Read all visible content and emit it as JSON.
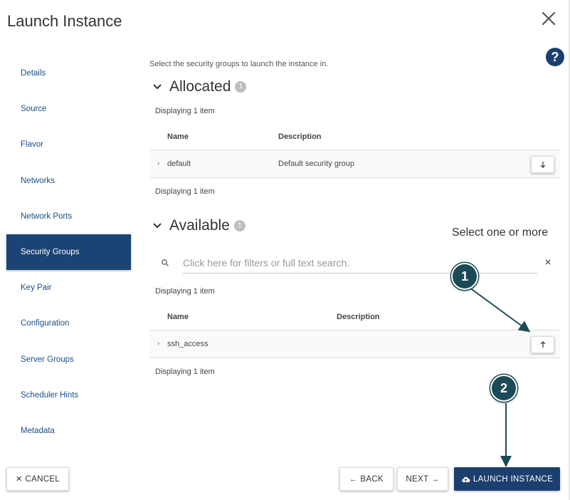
{
  "dialog": {
    "title": "Launch Instance",
    "help_label": "?"
  },
  "sidebar": {
    "items": [
      {
        "label": "Details",
        "active": false
      },
      {
        "label": "Source",
        "active": false
      },
      {
        "label": "Flavor",
        "active": false
      },
      {
        "label": "Networks",
        "active": false
      },
      {
        "label": "Network Ports",
        "active": false
      },
      {
        "label": "Security Groups",
        "active": true
      },
      {
        "label": "Key Pair",
        "active": false
      },
      {
        "label": "Configuration",
        "active": false
      },
      {
        "label": "Server Groups",
        "active": false
      },
      {
        "label": "Scheduler Hints",
        "active": false
      },
      {
        "label": "Metadata",
        "active": false
      }
    ]
  },
  "main": {
    "intro": "Select the security groups to launch the instance in.",
    "allocated": {
      "title": "Allocated",
      "count": "1",
      "display_top": "Displaying 1 item",
      "display_bottom": "Displaying 1 item",
      "col_name": "Name",
      "col_description": "Description",
      "rows": [
        {
          "name": "default",
          "description": "Default security group"
        }
      ]
    },
    "available": {
      "title": "Available",
      "count": "1",
      "hint": "Select one or more",
      "search_placeholder": "Click here for filters or full text search.",
      "display_top": "Displaying 1 item",
      "display_bottom": "Displaying 1 item",
      "col_name": "Name",
      "col_description": "Description",
      "rows": [
        {
          "name": "ssh_access",
          "description": ""
        }
      ]
    }
  },
  "annotations": {
    "marker1": "1",
    "marker2": "2",
    "color": "#1d4a57"
  },
  "footer": {
    "cancel": "CANCEL",
    "back": "BACK",
    "next": "NEXT",
    "launch": "LAUNCH INSTANCE"
  },
  "colors": {
    "primary": "#1b3f6e",
    "sidebar_active": "#1b4373",
    "link": "#1b4f86"
  }
}
